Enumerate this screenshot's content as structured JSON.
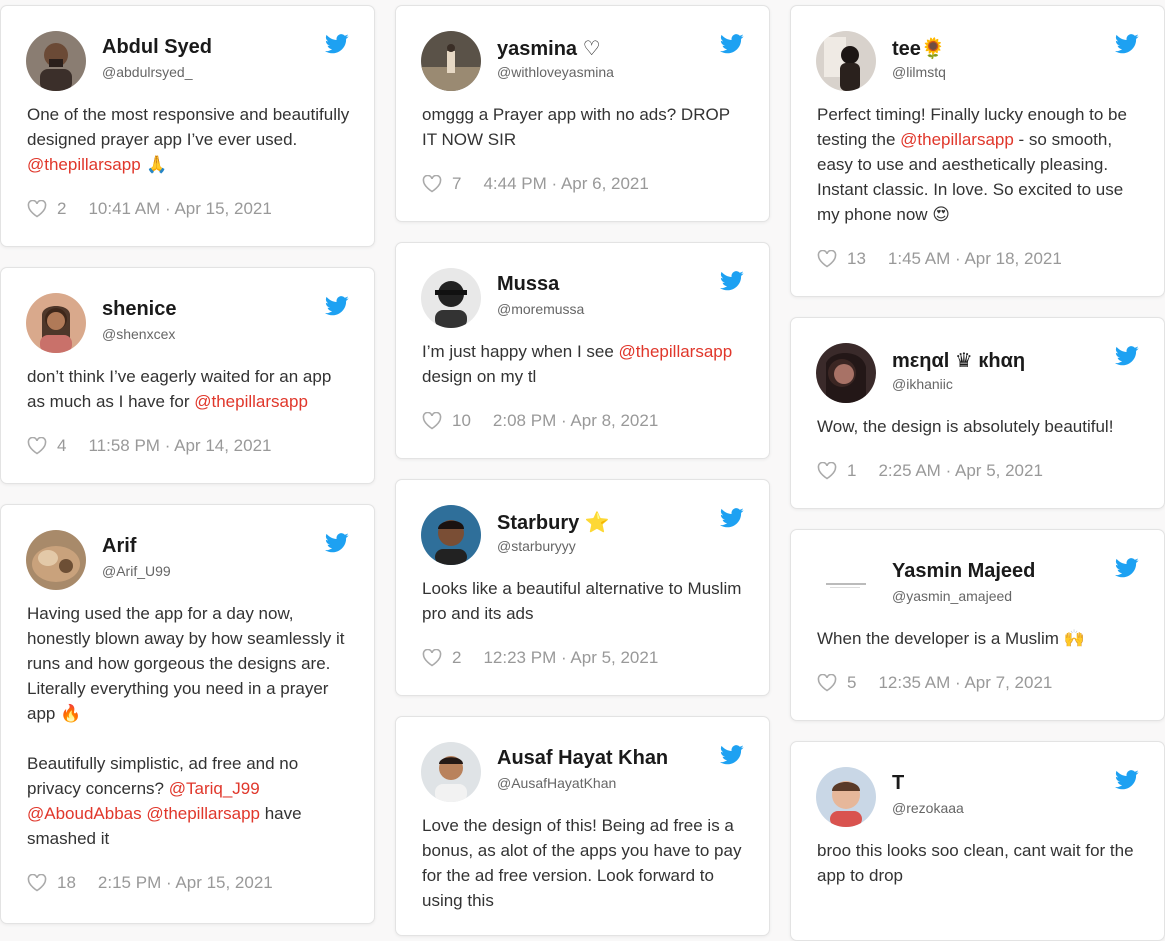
{
  "colors": {
    "mention": "#e0372b",
    "twitter": "#1da1f2",
    "background": "#f9f8f8"
  },
  "icons": {
    "brand": "twitter-bird-icon",
    "like": "heart-outline-icon"
  },
  "tweets": [
    {
      "name": "Abdul Syed",
      "handle": "@abdulrsyed_",
      "text_parts": [
        "One of the most responsive and beautifully designed prayer app I’ve ever used. ",
        "@thepillarsapp",
        " 🙏"
      ],
      "likes": "2",
      "time": "10:41 AM · Apr 15, 2021"
    },
    {
      "name": "yasmina ♡",
      "handle": "@withloveyasmina",
      "text_parts": [
        "omggg a Prayer app with no ads? DROP IT NOW SIR",
        "",
        ""
      ],
      "likes": "7",
      "time": "4:44 PM · Apr 6, 2021"
    },
    {
      "name": "tee🌻",
      "handle": "@lilmstq",
      "text_parts": [
        "Perfect timing! Finally lucky enough to be testing the ",
        "@thepillarsapp",
        " - so smooth, easy to use and aesthetically pleasing. Instant classic. In love. So excited to use my phone now 😍"
      ],
      "likes": "13",
      "time": "1:45 AM · Apr 18, 2021"
    },
    {
      "name": "shenice",
      "handle": "@shenxcex",
      "text_parts": [
        "don’t think I’ve eagerly waited for an app as much as I have for ",
        "@thepillarsapp",
        ""
      ],
      "likes": "4",
      "time": "11:58 PM · Apr 14, 2021"
    },
    {
      "name": "Mussa",
      "handle": "@moremussa",
      "text_parts": [
        "I’m just happy when I see ",
        "@thepillarsapp",
        " design on my tl"
      ],
      "likes": "10",
      "time": "2:08 PM · Apr 8, 2021"
    },
    {
      "name": "mεηαl ♛ кhαη",
      "handle": "@ikhaniic",
      "text_parts": [
        "Wow, the design is absolutely beautiful!",
        "",
        ""
      ],
      "likes": "1",
      "time": "2:25 AM · Apr 5, 2021"
    },
    {
      "name": "Arif",
      "handle": "@Arif_U99",
      "text_parts": [
        "Having used the app for a day now, honestly blown away by how seamlessly it runs and how gorgeous the designs are. Literally everything you need in a prayer app 🔥\n\nBeautifully simplistic, ad free and no privacy concerns? ",
        "@Tariq_J99 @AboudAbbas @thepillarsapp",
        " have smashed it"
      ],
      "likes": "18",
      "time": "2:15 PM · Apr 15, 2021"
    },
    {
      "name": "Starbury ⭐",
      "handle": "@starburyyy",
      "text_parts": [
        "Looks like a beautiful alternative to Muslim pro and its ads",
        "",
        ""
      ],
      "likes": "2",
      "time": "12:23 PM · Apr 5, 2021"
    },
    {
      "name": "Yasmin Majeed",
      "handle": "@yasmin_amajeed",
      "text_parts": [
        "When the developer is a Muslim 🙌",
        "",
        ""
      ],
      "likes": "5",
      "time": "12:35 AM · Apr 7, 2021"
    },
    {
      "name": "Ausaf Hayat Khan",
      "handle": "@AusafHayatKhan",
      "text_parts": [
        "Love the design of this! Being ad free is a bonus, as alot of the apps you have to pay for the ad free version. Look forward to using this",
        "",
        ""
      ],
      "likes": "",
      "time": ""
    },
    {
      "name": "T",
      "handle": "@rezokaaa",
      "text_parts": [
        "broo this looks soo clean, cant wait for the app to drop",
        "",
        ""
      ],
      "likes": "",
      "time": ""
    }
  ]
}
